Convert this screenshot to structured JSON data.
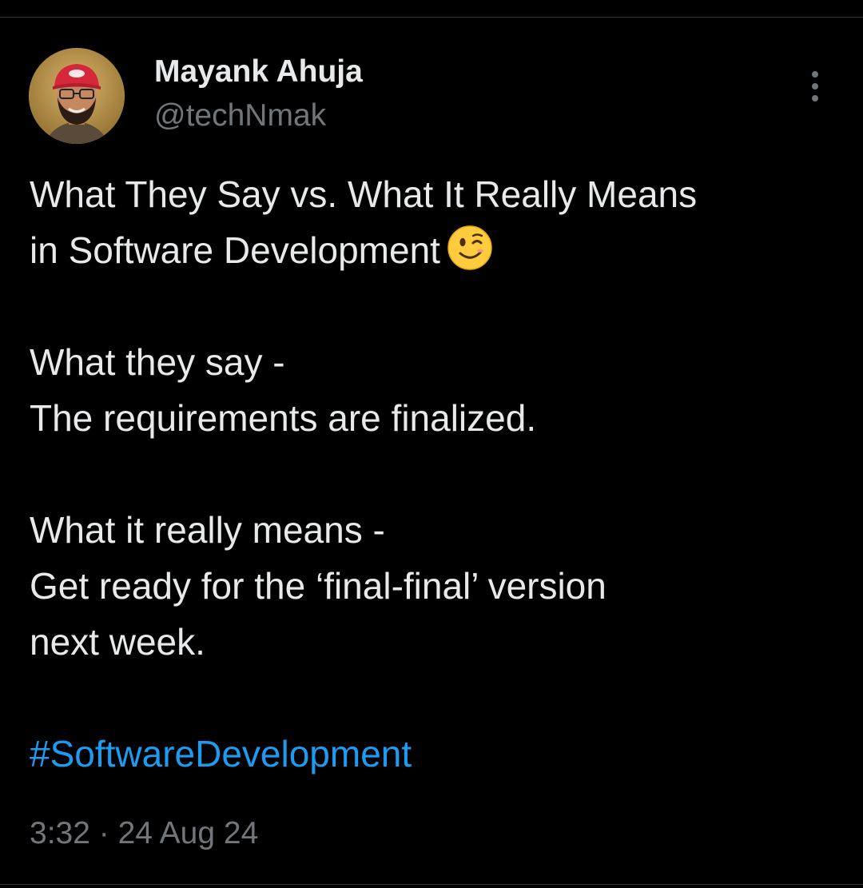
{
  "author": {
    "display_name": "Mayank Ahuja",
    "handle": "@techNmak"
  },
  "icons": {
    "more": "more-vertical-icon",
    "emoji": "winking-face-emoji"
  },
  "tweet": {
    "title_line1": "What They Say vs. What It Really Means",
    "title_line2": "in Software Development",
    "say_heading": "What they say -",
    "say_text": "The requirements are finalized.",
    "means_heading": "What it really means -",
    "means_text_line1": "Get ready for the ‘final-final’ version",
    "means_text_line2": "next week.",
    "hashtag": "#SoftwareDevelopment"
  },
  "meta": {
    "time": "3:32",
    "separator": "·",
    "date": "24 Aug 24"
  },
  "colors": {
    "background": "#000000",
    "text_primary": "#e7e9ea",
    "text_secondary": "#71767b",
    "link": "#1d9bf0"
  }
}
